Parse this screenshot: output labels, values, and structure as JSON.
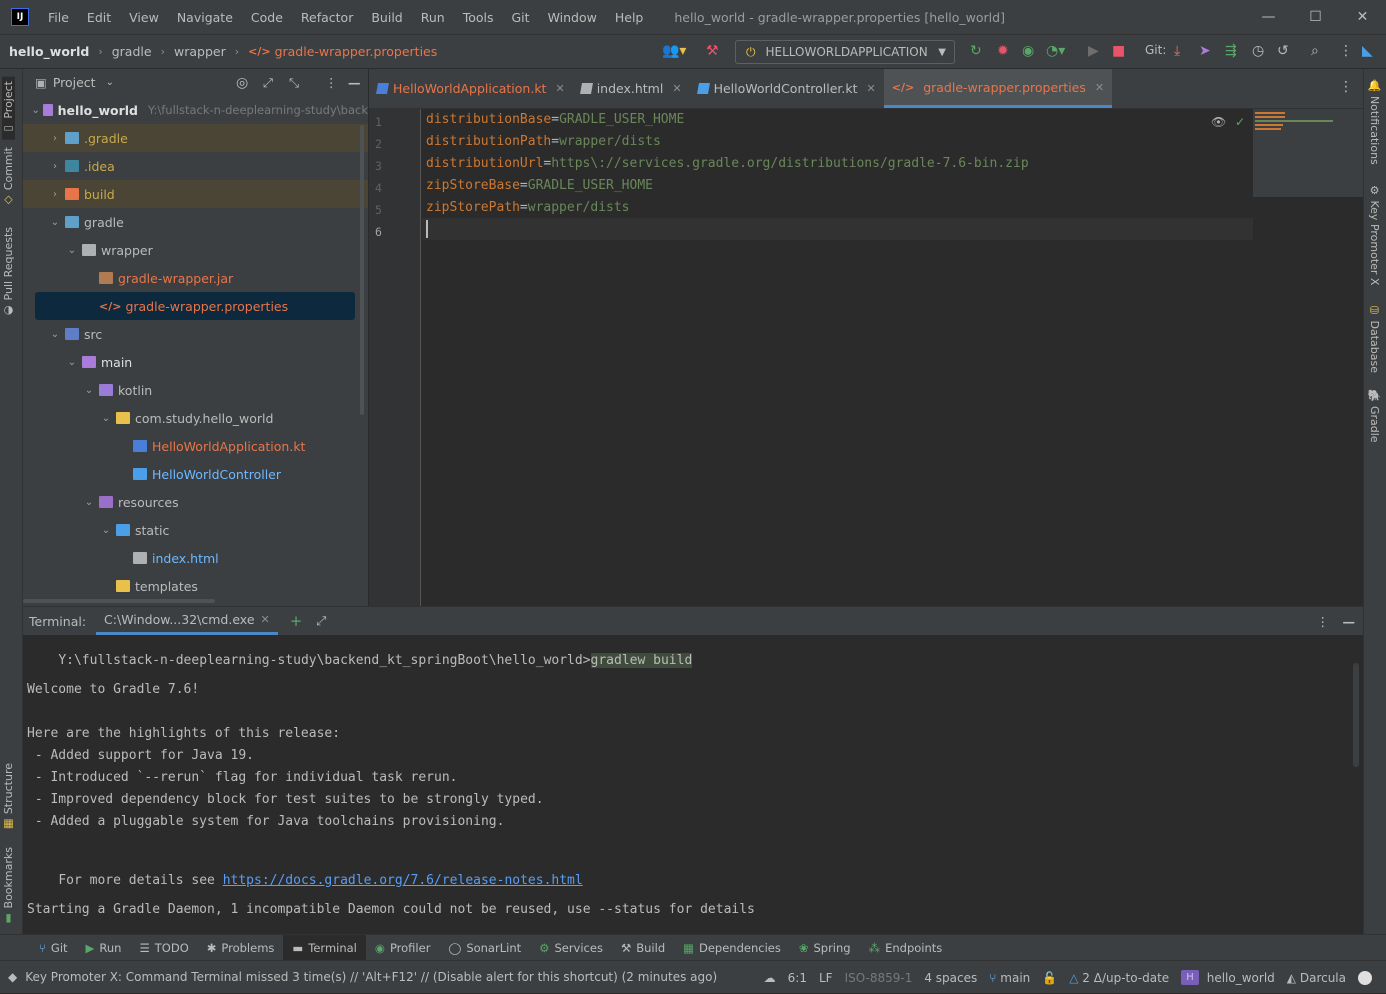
{
  "app": {
    "logo": "IJ",
    "window_title": "hello_world - gradle-wrapper.properties [hello_world]",
    "menu": [
      "File",
      "Edit",
      "View",
      "Navigate",
      "Code",
      "Refactor",
      "Build",
      "Run",
      "Tools",
      "Git",
      "Window",
      "Help"
    ],
    "controls": {
      "minimize": "—",
      "maximize": "☐",
      "close": "✕"
    }
  },
  "nav": {
    "breadcrumbs": [
      "hello_world",
      "gradle",
      "wrapper",
      "gradle-wrapper.properties"
    ],
    "run_config": "HELLOWORLDAPPLICATION",
    "git_label": "Git:"
  },
  "left_tools": [
    "Project",
    "Commit",
    "Pull Requests",
    "Structure",
    "Bookmarks"
  ],
  "right_tools": [
    "Notifications",
    "Key Promoter X",
    "Database",
    "Gradle"
  ],
  "project": {
    "title": "Project",
    "root_name": "hello_world",
    "root_path": "Y:\\fullstack-n-deeplearning-study\\back",
    "tree": [
      {
        "label": ".gradle",
        "depth": 1,
        "arrow": "›",
        "icon": "#5fa0c8",
        "color": "#c9a94a",
        "bg": "gitchg"
      },
      {
        "label": ".idea",
        "depth": 1,
        "arrow": "›",
        "icon": "#3e86a0",
        "color": "#c9a94a",
        "bg": ""
      },
      {
        "label": "build",
        "depth": 1,
        "arrow": "›",
        "icon": "#e8754a",
        "color": "#c9a94a",
        "bg": "gitchg"
      },
      {
        "label": "gradle",
        "depth": 1,
        "arrow": "⌄",
        "icon": "#5fa0c8",
        "color": "#bbbbbb",
        "bg": ""
      },
      {
        "label": "wrapper",
        "depth": 2,
        "arrow": "⌄",
        "icon": "#aeb0b2",
        "color": "#bbbbbb",
        "bg": ""
      },
      {
        "label": "gradle-wrapper.jar",
        "depth": 3,
        "arrow": "",
        "icon": "#b07a52",
        "color": "#e8754a",
        "bg": ""
      },
      {
        "label": "gradle-wrapper.properties",
        "depth": 3,
        "arrow": "",
        "icon": "",
        "color": "#e8754a",
        "bg": "sel"
      },
      {
        "label": "src",
        "depth": 1,
        "arrow": "⌄",
        "icon": "#5f7ec8",
        "color": "#bbbbbb",
        "bg": ""
      },
      {
        "label": "main",
        "depth": 2,
        "arrow": "⌄",
        "icon": "#a87cd8",
        "color": "#dfdfdf",
        "bg": ""
      },
      {
        "label": "kotlin",
        "depth": 3,
        "arrow": "⌄",
        "icon": "#9a7cd8",
        "color": "#bbbbbb",
        "bg": ""
      },
      {
        "label": "com.study.hello_world",
        "depth": 4,
        "arrow": "⌄",
        "icon": "#e8c04a",
        "color": "#bbbbbb",
        "bg": ""
      },
      {
        "label": "HelloWorldApplication.kt",
        "depth": 5,
        "arrow": "",
        "icon": "#4a7fd8",
        "color": "#e8754a",
        "bg": ""
      },
      {
        "label": "HelloWorldController",
        "depth": 5,
        "arrow": "",
        "icon": "#4a9fe8",
        "color": "#6fb8ff",
        "bg": ""
      },
      {
        "label": "resources",
        "depth": 3,
        "arrow": "⌄",
        "icon": "#9a6fc8",
        "color": "#bbbbbb",
        "bg": ""
      },
      {
        "label": "static",
        "depth": 4,
        "arrow": "⌄",
        "icon": "#4a9fe8",
        "color": "#bbbbbb",
        "bg": ""
      },
      {
        "label": "index.html",
        "depth": 5,
        "arrow": "",
        "icon": "#aeb0b2",
        "color": "#6fb8ff",
        "bg": ""
      },
      {
        "label": "templates",
        "depth": 4,
        "arrow": "",
        "icon": "#e8c04a",
        "color": "#bbbbbb",
        "bg": ""
      }
    ]
  },
  "editor": {
    "tabs": [
      {
        "label": "HelloWorldApplication.kt",
        "color": "#e8754a",
        "icon": "#4a7fd8"
      },
      {
        "label": "index.html",
        "color": "#bbbbbb",
        "icon": "#aeb0b2"
      },
      {
        "label": "HelloWorldController.kt",
        "color": "#bbbbbb",
        "icon": "#4a9fe8"
      },
      {
        "label": "gradle-wrapper.properties",
        "color": "#e8754a",
        "icon": ""
      }
    ],
    "lines": [
      {
        "n": "1",
        "key": "distributionBase",
        "val": "GRADLE_USER_HOME"
      },
      {
        "n": "2",
        "key": "distributionPath",
        "val": "wrapper/dists"
      },
      {
        "n": "3",
        "key": "distributionUrl",
        "val": "https\\://services.gradle.org/distributions/gradle-7.6-bin.zip"
      },
      {
        "n": "4",
        "key": "zipStoreBase",
        "val": "GRADLE_USER_HOME"
      },
      {
        "n": "5",
        "key": "zipStorePath",
        "val": "wrapper/dists"
      },
      {
        "n": "6",
        "key": "",
        "val": ""
      }
    ]
  },
  "terminal": {
    "label": "Terminal:",
    "tab": "C:\\Window...32\\cmd.exe",
    "prompt": "Y:\\fullstack-n-deeplearning-study\\backend_kt_springBoot\\hello_world>",
    "command": "gradlew build",
    "output": [
      "",
      "Welcome to Gradle 7.6!",
      "",
      "Here are the highlights of this release:",
      " - Added support for Java 19.",
      " - Introduced `--rerun` flag for individual task rerun.",
      " - Improved dependency block for test suites to be strongly typed.",
      " - Added a pluggable system for Java toolchains provisioning.",
      ""
    ],
    "details_prefix": "For more details see ",
    "details_link": "https://docs.gradle.org/7.6/release-notes.html",
    "daemon_line": "Starting a Gradle Daemon, 1 incompatible Daemon could not be reused, use --status for details"
  },
  "bottom_tools": [
    {
      "label": "Git",
      "icon": "⑂",
      "color": "#6fb8ff"
    },
    {
      "label": "Run",
      "icon": "▶",
      "color": "#59a869"
    },
    {
      "label": "TODO",
      "icon": "☰",
      "color": "#bbbbbb"
    },
    {
      "label": "Problems",
      "icon": "✱",
      "color": "#bbbbbb"
    },
    {
      "label": "Terminal",
      "icon": "▬",
      "color": "#bbbbbb",
      "active": true
    },
    {
      "label": "Profiler",
      "icon": "◉",
      "color": "#59a869"
    },
    {
      "label": "SonarLint",
      "icon": "◯",
      "color": "#bbbbbb"
    },
    {
      "label": "Services",
      "icon": "⚙",
      "color": "#59a869"
    },
    {
      "label": "Build",
      "icon": "⚒",
      "color": "#bbbbbb"
    },
    {
      "label": "Dependencies",
      "icon": "▦",
      "color": "#59a869"
    },
    {
      "label": "Spring",
      "icon": "❀",
      "color": "#59a869"
    },
    {
      "label": "Endpoints",
      "icon": "⁂",
      "color": "#59a869"
    }
  ],
  "status": {
    "message": "Key Promoter X: Command Terminal missed 3 time(s) // 'Alt+F12' // (Disable alert for this shortcut) (2 minutes ago)",
    "position": "6:1",
    "line_sep": "LF",
    "encoding": "ISO-8859-1",
    "indent": "4 spaces",
    "branch": "main",
    "vcs_status": "2 Δ/up-to-date",
    "project": "hello_world",
    "project_badge": "H",
    "theme": "Darcula"
  }
}
